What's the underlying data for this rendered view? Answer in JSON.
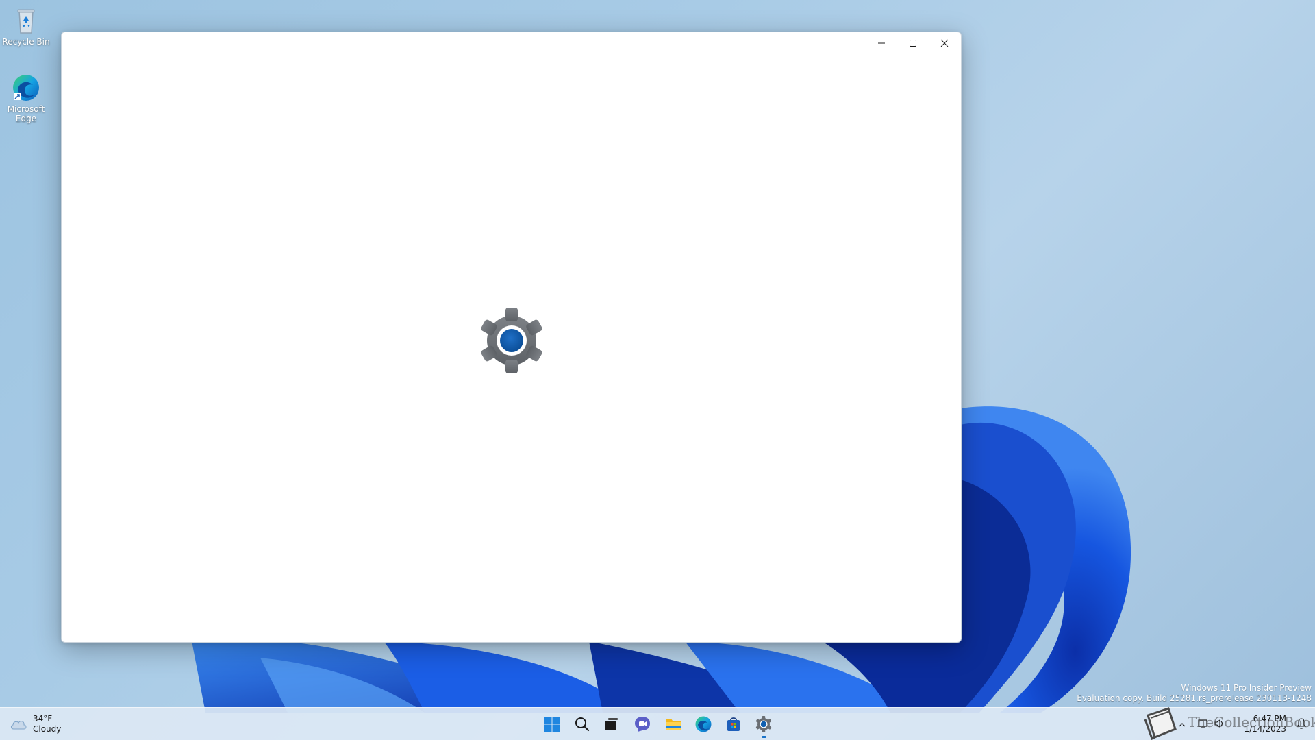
{
  "desktop": {
    "icons": [
      {
        "label": "Recycle Bin",
        "icon": "recycle-bin-icon"
      },
      {
        "label": "Microsoft Edge",
        "icon": "edge-icon"
      }
    ],
    "watermark": {
      "line1": "Windows 11 Pro Insider Preview",
      "line2": "Evaluation copy. Build 25281.rs_prerelease.230113-1248"
    }
  },
  "window": {
    "app_icon": "settings-gear-icon",
    "controls": [
      "minimize",
      "maximize",
      "close"
    ]
  },
  "taskbar": {
    "weather": {
      "temp": "34°F",
      "condition": "Cloudy"
    },
    "apps": [
      {
        "name": "start",
        "icon": "windows-start-icon"
      },
      {
        "name": "search",
        "icon": "search-icon"
      },
      {
        "name": "task-view",
        "icon": "task-view-icon"
      },
      {
        "name": "chat",
        "icon": "chat-icon"
      },
      {
        "name": "file-explorer",
        "icon": "folder-icon"
      },
      {
        "name": "edge",
        "icon": "edge-icon"
      },
      {
        "name": "store",
        "icon": "store-icon"
      },
      {
        "name": "settings",
        "icon": "settings-gear-icon",
        "running": true
      }
    ],
    "tray": {
      "time": "6:47 PM",
      "date": "1/14/2023",
      "overlay_text": "TheCollectionBook"
    }
  },
  "colors": {
    "accent": "#0f5fb0",
    "gear_gray": "#6f7378",
    "taskbar_bg": "#dce8f4"
  }
}
